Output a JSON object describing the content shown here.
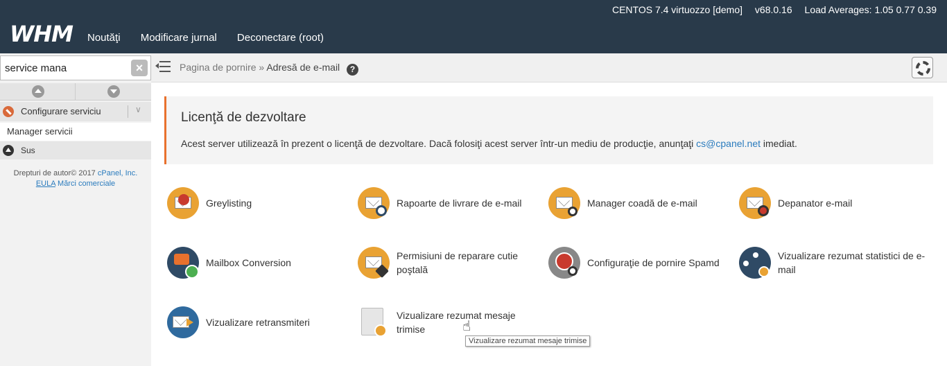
{
  "header": {
    "logo": "WHM",
    "server": "CENTOS 7.4 virtuozzo [demo]",
    "version": "v68.0.16",
    "load": "Load Averages: 1.05 0.77 0.39",
    "nav": [
      "Noutăţi",
      "Modificare jurnal",
      "Deconectare (root)"
    ]
  },
  "sidebar": {
    "search_value": "service mana",
    "category": "Configurare serviciu",
    "subitem": "Manager servicii",
    "top_label": "Sus",
    "copyright_prefix": "Drepturi de autor© 2017",
    "copyright_link": "cPanel, Inc.",
    "eula": "EULA",
    "trademarks": "Mărci comerciale"
  },
  "breadcrumb": {
    "home": "Pagina de pornire",
    "separator": "»",
    "current": "Adresă de e-mail",
    "help": "?"
  },
  "notice": {
    "title": "Licenţă de dezvoltare",
    "text_before": "Acest server utilizează în prezent o licenţă de dezvoltare. Dacă folosiţi acest server într-un mediu de producţie, anunţaţi",
    "email": "cs@cpanel.net",
    "text_after": "imediat."
  },
  "tools": [
    {
      "label": "Greylisting",
      "icon": "greylisting-icon"
    },
    {
      "label": "Rapoarte de livrare de e-mail",
      "icon": "delivery-reports-icon"
    },
    {
      "label": "Manager coadă de e-mail",
      "icon": "queue-manager-icon"
    },
    {
      "label": "Depanator e-mail",
      "icon": "email-troubleshooter-icon"
    },
    {
      "label": "Mailbox Conversion",
      "icon": "mailbox-conversion-icon"
    },
    {
      "label": "Permisiuni de reparare cutie poştală",
      "icon": "mailbox-repair-icon"
    },
    {
      "label": "Configuraţie de pornire Spamd",
      "icon": "spamd-config-icon"
    },
    {
      "label": "Vizualizare rezumat statistici de e-mail",
      "icon": "email-stats-icon"
    },
    {
      "label": "Vizualizare retransmiteri",
      "icon": "relayers-icon"
    },
    {
      "label": "Vizualizare rezumat mesaje trimise",
      "icon": "sent-summary-icon"
    }
  ],
  "tooltip": "Vizualizare rezumat mesaje trimise",
  "colors": {
    "header_bg": "#293a4a",
    "accent_orange": "#e8712d",
    "link_blue": "#2a7bbd"
  }
}
